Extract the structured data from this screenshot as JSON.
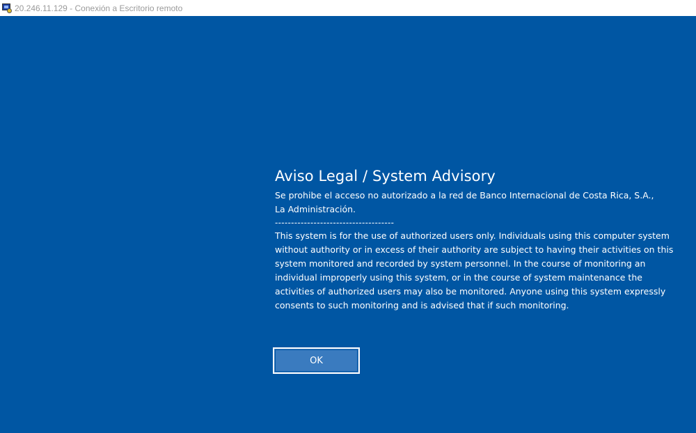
{
  "window": {
    "title": "20.246.11.129 - Conexión a Escritorio remoto",
    "icon": "remote-desktop-icon"
  },
  "colors": {
    "desktop_background": "#0056a3",
    "button_background": "#3a7bbf",
    "text": "#ffffff"
  },
  "notice": {
    "title": "Aviso Legal / System Advisory",
    "line1": "Se prohibe el acceso no autorizado a la red de Banco Internacional de Costa Rica, S.A.,",
    "line2": "La Administración.",
    "separator": "-------------------------------------",
    "body": "This system is for the use of authorized users only. Individuals using this computer system without authority or in excess of their authority are subject to having their activities on this system monitored and recorded by system personnel. In the course of monitoring an individual improperly using this system, or in the course of system maintenance the activities of authorized users may also be monitored. Anyone using this system expressly consents to such monitoring and is advised that if such monitoring."
  },
  "buttons": {
    "ok_label": "OK"
  }
}
